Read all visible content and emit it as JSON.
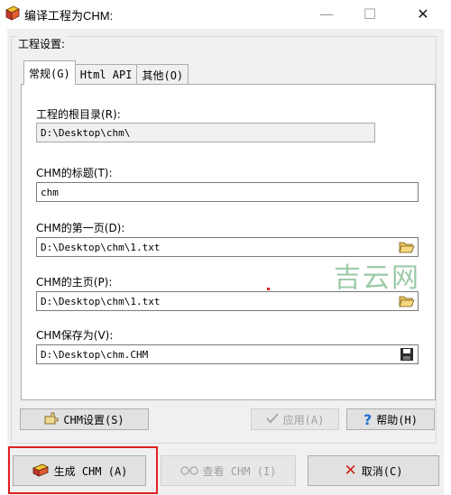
{
  "window": {
    "title": "编译工程为CHM:",
    "minimize_glyph": "—",
    "maximize_glyph": "☐",
    "close_glyph": "✕"
  },
  "group": {
    "title": "工程设置:"
  },
  "tabs": [
    {
      "label": "常规(G)",
      "active": true
    },
    {
      "label": "Html API",
      "active": false
    },
    {
      "label": "其他(O)",
      "active": false
    }
  ],
  "fields": {
    "root": {
      "label": "工程的根目录(R):",
      "value": "D:\\Desktop\\chm\\"
    },
    "title": {
      "label": "CHM的标题(T):",
      "value": "chm"
    },
    "first_page": {
      "label": "CHM的第一页(D):",
      "value": "D:\\Desktop\\chm\\1.txt"
    },
    "home_page": {
      "label": "CHM的主页(P):",
      "value": "D:\\Desktop\\chm\\1.txt"
    },
    "save_as": {
      "label": "CHM保存为(V):",
      "value": "D:\\Desktop\\chm.CHM"
    }
  },
  "buttons": {
    "chm_settings": "CHM设置(S)",
    "apply": "应用(A)",
    "help": "帮助(H)",
    "build": "生成 CHM (A)",
    "view": "查看 CHM (I)",
    "cancel": "取消(C)"
  },
  "watermark": "吉云网",
  "colors": {
    "highlight": "#e02020",
    "watermark": "#8cc29a",
    "help_icon": "#1e6fd0",
    "cancel_icon": "#d01f1f"
  }
}
